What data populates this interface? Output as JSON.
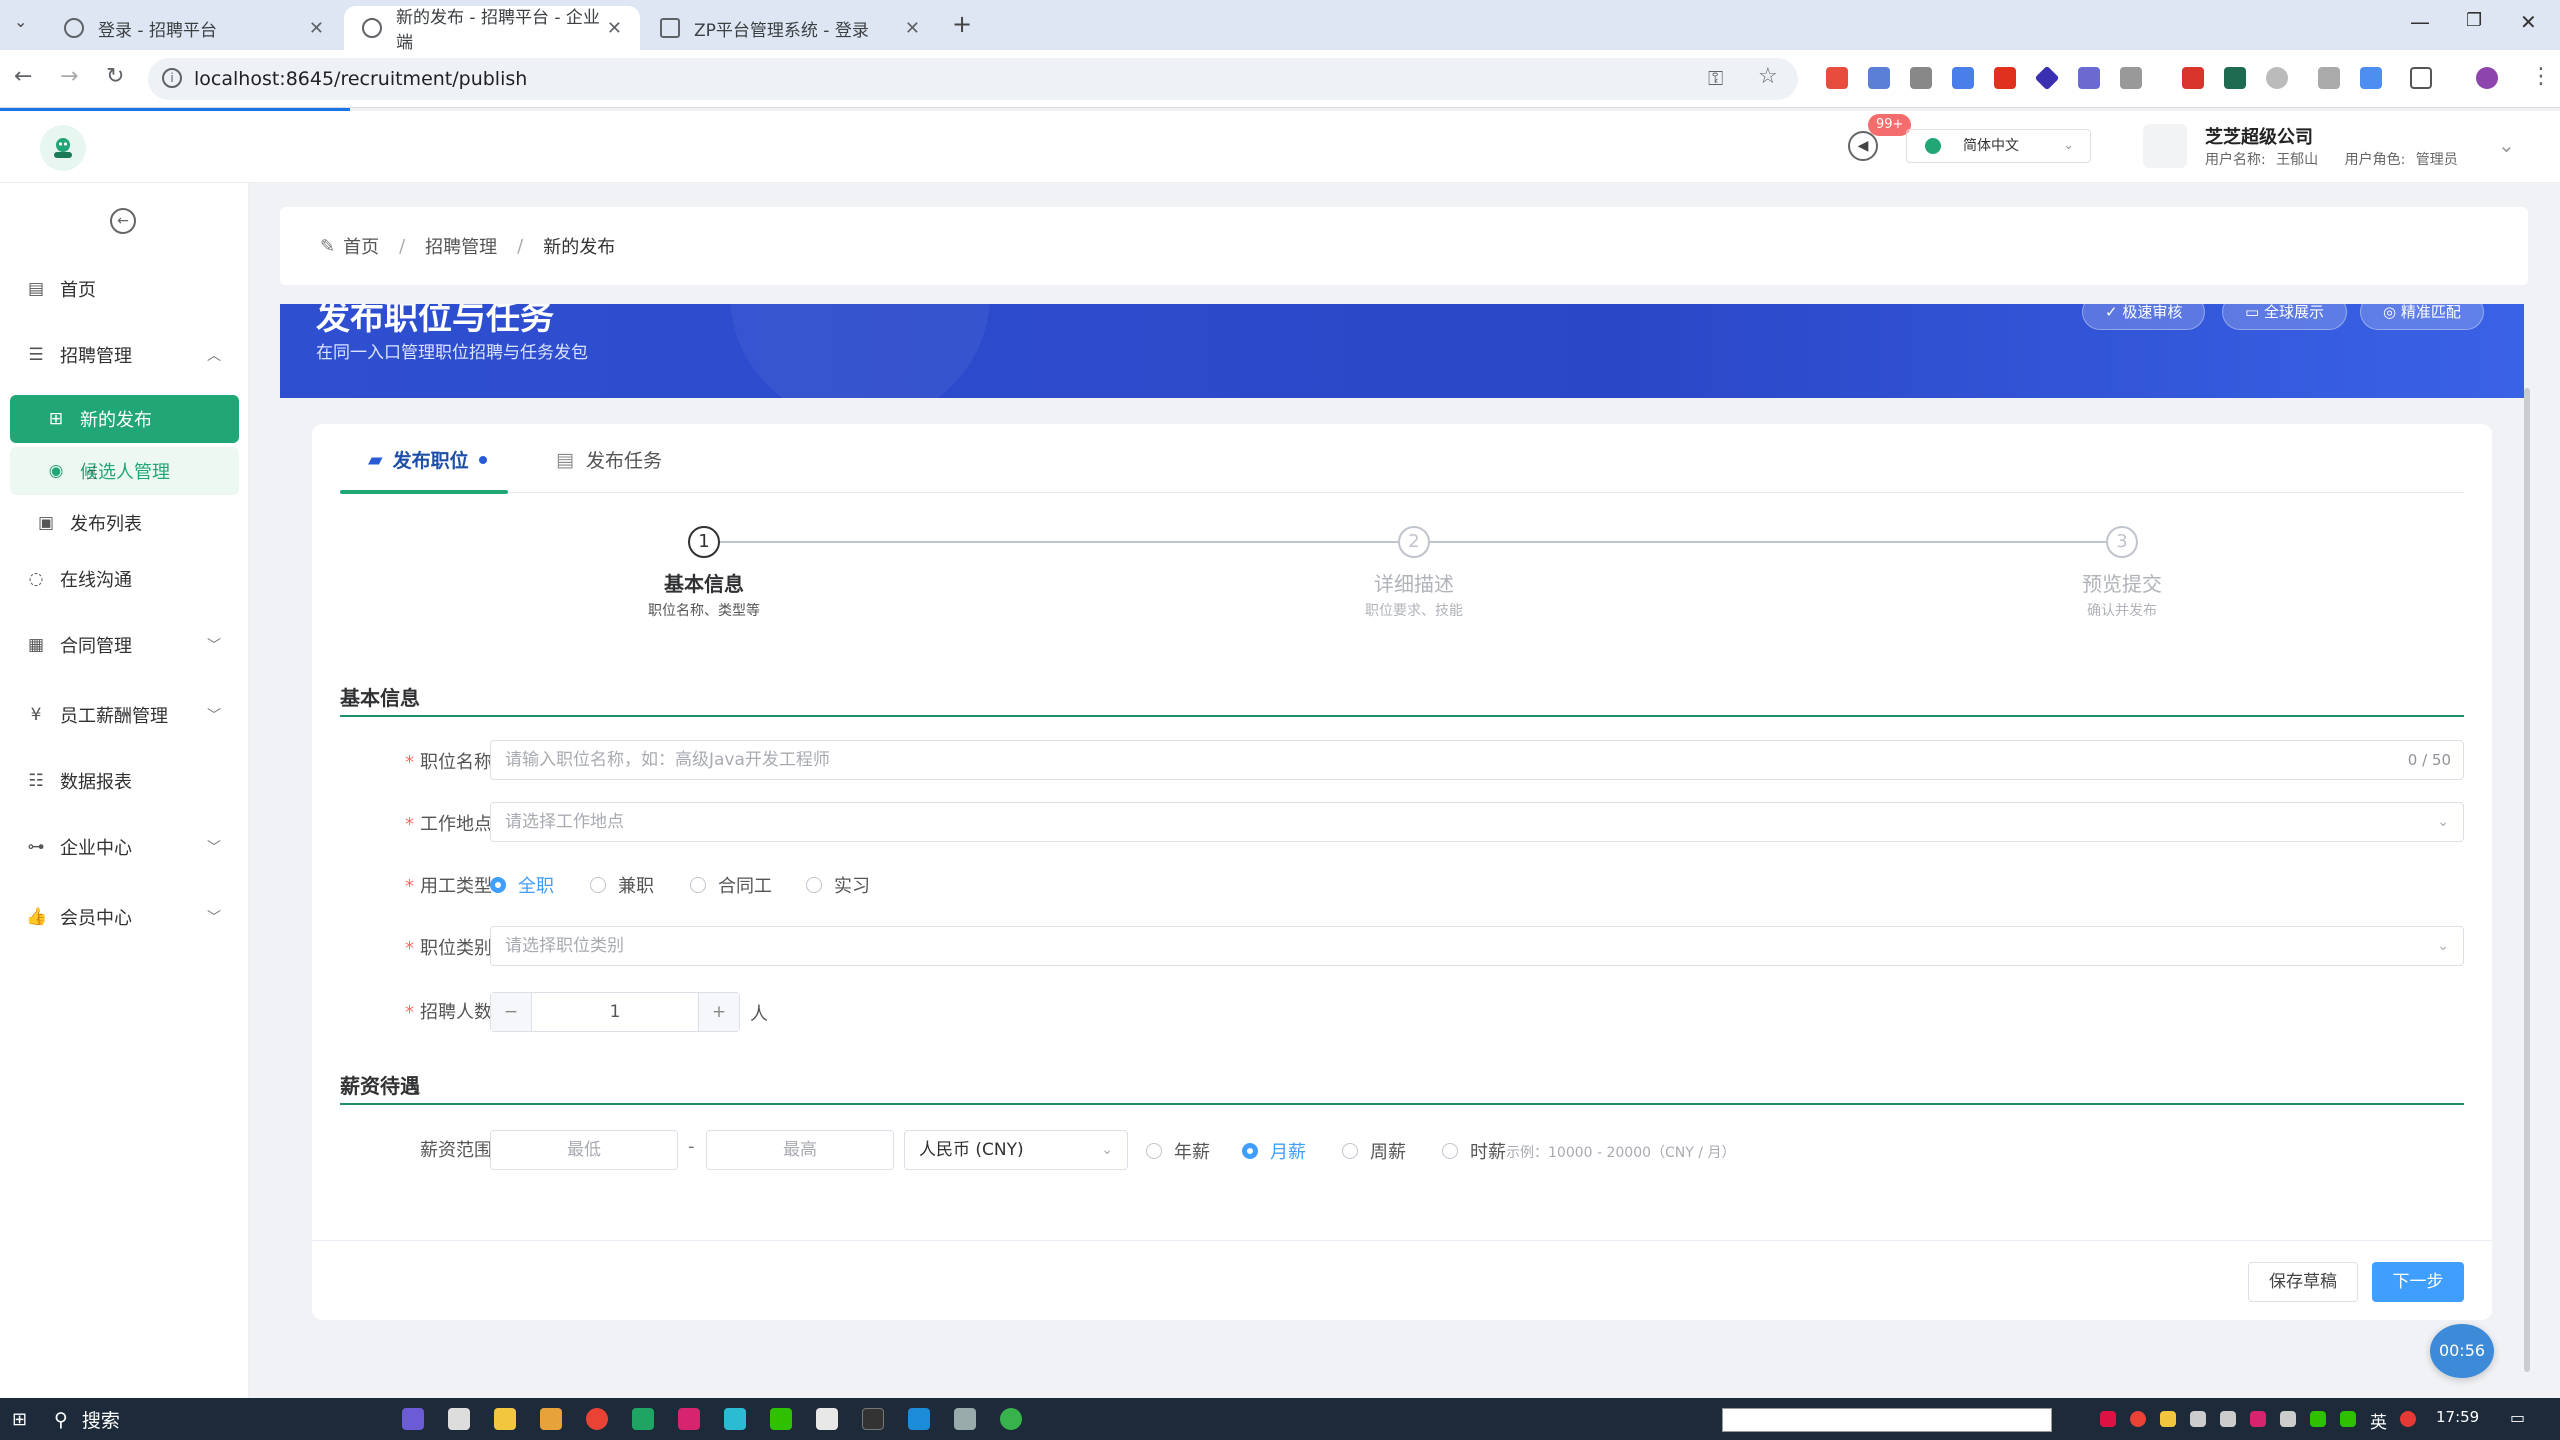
{
  "browser": {
    "tabs": [
      {
        "title": "登录 - 招聘平台"
      },
      {
        "title": "新的发布 - 招聘平台 - 企业端"
      },
      {
        "title": "ZP平台管理系统 - 登录"
      }
    ],
    "url": "localhost:8645/recruitment/publish"
  },
  "header": {
    "badge": "99+",
    "language": "简体中文",
    "company": "芝芝超级公司",
    "username_label": "用户名称:",
    "username": "王郁山",
    "role_label": "用户角色:",
    "role": "管理员"
  },
  "sidebar": {
    "items": [
      {
        "label": "首页"
      },
      {
        "label": "招聘管理"
      },
      {
        "label": "新的发布"
      },
      {
        "label": "候选人管理"
      },
      {
        "label": "发布列表"
      },
      {
        "label": "在线沟通"
      },
      {
        "label": "合同管理"
      },
      {
        "label": "员工薪酬管理"
      },
      {
        "label": "数据报表"
      },
      {
        "label": "企业中心"
      },
      {
        "label": "会员中心"
      }
    ]
  },
  "breadcrumb": [
    "首页",
    "招聘管理",
    "新的发布"
  ],
  "banner": {
    "title": "发布职位与任务",
    "subtitle": "在同一入口管理职位招聘与任务发包",
    "buttons": [
      "极速审核",
      "全球展示",
      "精准匹配"
    ]
  },
  "tabs": {
    "job": "发布职位",
    "task": "发布任务"
  },
  "steps": [
    {
      "num": "1",
      "title": "基本信息",
      "desc": "职位名称、类型等"
    },
    {
      "num": "2",
      "title": "详细描述",
      "desc": "职位要求、技能"
    },
    {
      "num": "3",
      "title": "预览提交",
      "desc": "确认并发布"
    }
  ],
  "form": {
    "section_basic": "基本信息",
    "job_name_label": "职位名称",
    "job_name_placeholder": "请输入职位名称，如：高级Java开发工程师",
    "job_name_count": "0 / 50",
    "location_label": "工作地点",
    "location_placeholder": "请选择工作地点",
    "employment_label": "用工类型",
    "employment_options": [
      "全职",
      "兼职",
      "合同工",
      "实习"
    ],
    "employment_selected": "全职",
    "category_label": "职位类别",
    "category_placeholder": "请选择职位类别",
    "headcount_label": "招聘人数",
    "headcount_value": "1",
    "headcount_unit": "人",
    "section_salary": "薪资待遇",
    "salary_label": "薪资范围",
    "salary_min_placeholder": "最低",
    "salary_max_placeholder": "最高",
    "salary_sep": "-",
    "currency": "人民币 (CNY)",
    "period_options": [
      "年薪",
      "月薪",
      "周薪",
      "时薪"
    ],
    "period_selected": "月薪",
    "salary_example": "示例：10000 - 20000（CNY / 月）"
  },
  "actions": {
    "draft": "保存草稿",
    "next": "下一步"
  },
  "timer": "00:56",
  "taskbar": {
    "search": "搜索",
    "time": "17:59",
    "ime": "英"
  }
}
